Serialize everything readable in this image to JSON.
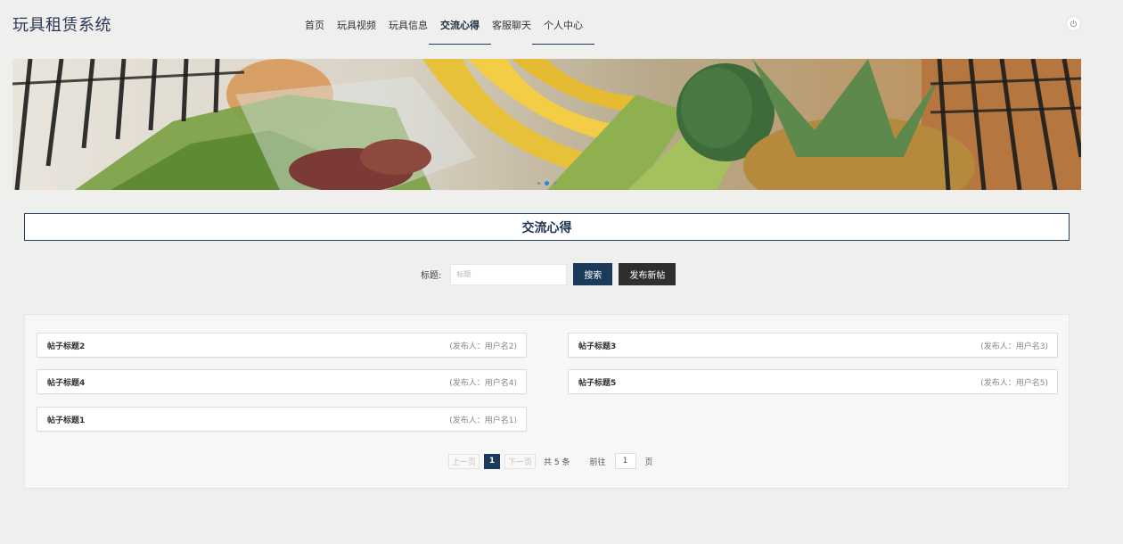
{
  "header": {
    "logo": "玩具租赁系统",
    "nav": [
      {
        "label": "首页"
      },
      {
        "label": "玩具视频"
      },
      {
        "label": "玩具信息"
      },
      {
        "label": "交流心得"
      },
      {
        "label": "客服聊天"
      },
      {
        "label": "个人中心"
      }
    ],
    "active_nav": "交流心得"
  },
  "section": {
    "title": "交流心得"
  },
  "search": {
    "label": "标题:",
    "placeholder": "标题",
    "search_button": "搜索",
    "new_post_button": "发布新帖"
  },
  "posts": [
    {
      "title": "帖子标题2",
      "author": "(发布人：用户名2)"
    },
    {
      "title": "帖子标题3",
      "author": "(发布人：用户名3)"
    },
    {
      "title": "帖子标题4",
      "author": "(发布人：用户名4)"
    },
    {
      "title": "帖子标题5",
      "author": "(发布人：用户名5)"
    },
    {
      "title": "帖子标题1",
      "author": "(发布人：用户名1)"
    }
  ],
  "pagination": {
    "prev": "上一页",
    "current": "1",
    "next": "下一页",
    "total": "共 5 条",
    "goto": "前往",
    "page_value": "1",
    "page_suffix": "页"
  },
  "colors": {
    "primary": "#1b3a5c",
    "dark_button": "#2f2f2f",
    "background": "#efefed"
  }
}
